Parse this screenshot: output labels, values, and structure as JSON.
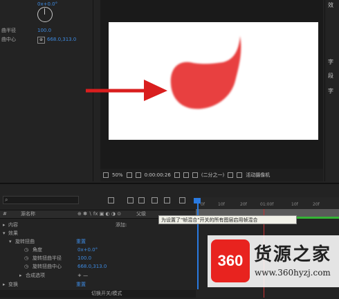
{
  "effect_controls": {
    "angle_value": "0x+0.0°",
    "radius_label": "曲半径",
    "radius_value": "100.0",
    "center_label": "曲中心",
    "center_value": "668.0,313.0"
  },
  "viewer": {
    "zoom": "50%",
    "timecode": "0:00:00:26",
    "resolution": "(二分之一)",
    "camera": "活动摄像机"
  },
  "right_panel": {
    "items": [
      "效",
      "字",
      "段",
      "字"
    ]
  },
  "timeline": {
    "search_placeholder": "",
    "header_source": "源名称",
    "header_parent": "父级",
    "ruler_ticks": [
      "0f",
      "10f",
      "20f",
      "01:00f",
      "10f",
      "20f"
    ],
    "rows": [
      {
        "label": "内容",
        "value": "添加:"
      },
      {
        "label": "效果",
        "value": ""
      },
      {
        "label": "旋转扭曲",
        "value": "重置"
      },
      {
        "label": "角度",
        "value": "0x+0.0°"
      },
      {
        "label": "旋转扭曲半径",
        "value": "100.0"
      },
      {
        "label": "旋转扭曲中心",
        "value": "668.0,313.0"
      },
      {
        "label": "合成选项",
        "value": "+ —"
      },
      {
        "label": "变换",
        "value": "重置"
      }
    ],
    "tooltip": "为设置了\"帧混合\"开关的所有图层启用帧混合",
    "footer": "切换开关/模式"
  },
  "watermark": {
    "logo": "360",
    "brand": "货源之家",
    "url": "www.360hyzj.com"
  },
  "colors": {
    "blob": "#e8413f",
    "arrow": "#d91e1e",
    "accent_blue": "#3d8ae0",
    "work_bar_green": "#35b435"
  }
}
